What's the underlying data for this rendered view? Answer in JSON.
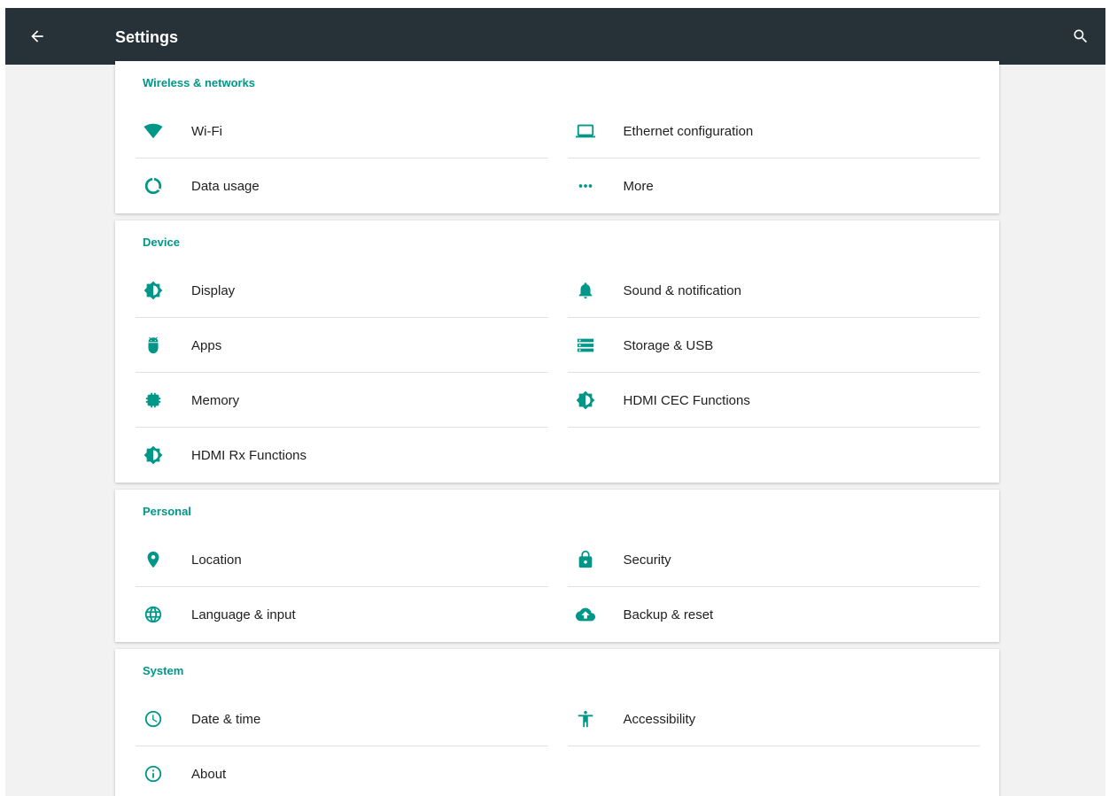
{
  "header": {
    "title": "Settings"
  },
  "colors": {
    "toolbar": "#263238",
    "accent": "#009688"
  },
  "sections": [
    {
      "title": "Wireless & networks",
      "items": [
        {
          "label": "Wi-Fi",
          "icon": "wifi-icon"
        },
        {
          "label": "Ethernet configuration",
          "icon": "laptop-icon"
        },
        {
          "label": "Data usage",
          "icon": "data-usage-icon"
        },
        {
          "label": "More",
          "icon": "more-horiz-icon"
        }
      ]
    },
    {
      "title": "Device",
      "items": [
        {
          "label": "Display",
          "icon": "brightness-icon"
        },
        {
          "label": "Sound & notification",
          "icon": "bell-icon"
        },
        {
          "label": "Apps",
          "icon": "android-icon"
        },
        {
          "label": "Storage & USB",
          "icon": "storage-icon"
        },
        {
          "label": "Memory",
          "icon": "memory-chip-icon"
        },
        {
          "label": "HDMI CEC Functions",
          "icon": "brightness-icon"
        },
        {
          "label": "HDMI Rx Functions",
          "icon": "brightness-icon"
        }
      ]
    },
    {
      "title": "Personal",
      "items": [
        {
          "label": "Location",
          "icon": "location-pin-icon"
        },
        {
          "label": "Security",
          "icon": "lock-icon"
        },
        {
          "label": "Language & input",
          "icon": "globe-icon"
        },
        {
          "label": "Backup & reset",
          "icon": "cloud-upload-icon"
        }
      ]
    },
    {
      "title": "System",
      "items": [
        {
          "label": "Date & time",
          "icon": "clock-icon"
        },
        {
          "label": "Accessibility",
          "icon": "accessibility-icon"
        },
        {
          "label": "About",
          "icon": "info-icon"
        }
      ]
    }
  ]
}
